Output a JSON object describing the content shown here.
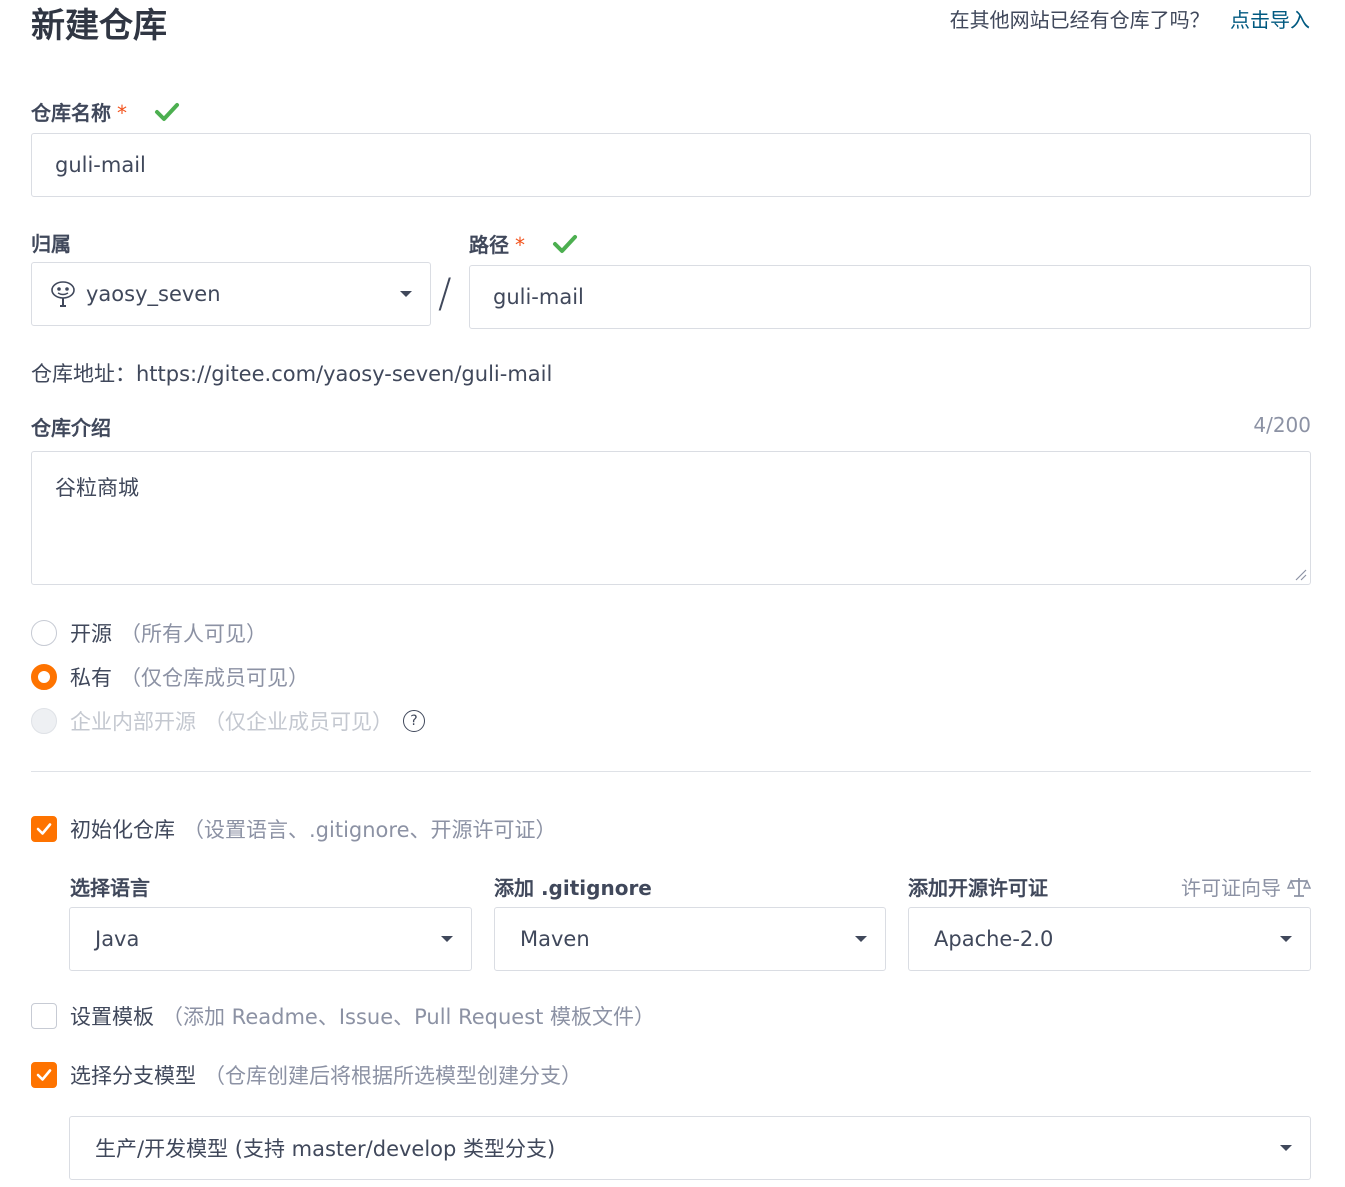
{
  "page": {
    "title": "新建仓库"
  },
  "import": {
    "prompt": "在其他网站已经有仓库了吗？",
    "link": "点击导入"
  },
  "repo_name": {
    "label": "仓库名称",
    "required": "*",
    "value": "guli-mail"
  },
  "owner": {
    "label": "归属",
    "value": "yaosy_seven"
  },
  "separator": "/",
  "path": {
    "label": "路径",
    "required": "*",
    "value": "guli-mail"
  },
  "repo_url": {
    "label": "仓库地址：",
    "value": "https://gitee.com/yaosy-seven/guli-mail"
  },
  "description": {
    "label": "仓库介绍",
    "counter": "4/200",
    "value": "谷粒商城"
  },
  "visibility": {
    "options": [
      {
        "label": "开源",
        "note": "（所有人可见）",
        "state": "unselected"
      },
      {
        "label": "私有",
        "note": "（仅仓库成员可见）",
        "state": "selected"
      },
      {
        "label": "企业内部开源",
        "note": "（仅企业成员可见）",
        "state": "disabled"
      }
    ],
    "help_glyph": "?"
  },
  "init_repo": {
    "label": "初始化仓库",
    "note": "（设置语言、.gitignore、开源许可证）",
    "checked": true
  },
  "language": {
    "label": "选择语言",
    "value": "Java"
  },
  "gitignore": {
    "label": "添加 .gitignore",
    "value": "Maven"
  },
  "license": {
    "label": "添加开源许可证",
    "guide": "许可证向导",
    "value": "Apache-2.0"
  },
  "template": {
    "label": "设置模板",
    "note": "（添加 Readme、Issue、Pull Request 模板文件）",
    "checked": false
  },
  "branch_model": {
    "label": "选择分支模型",
    "note": "（仓库创建后将根据所选模型创建分支）",
    "checked": true,
    "value": "生产/开发模型 (支持 master/develop 类型分支)"
  },
  "colors": {
    "accent": "#fe7300",
    "link": "#005980",
    "success": "#4caf50",
    "required": "#f2521b"
  }
}
